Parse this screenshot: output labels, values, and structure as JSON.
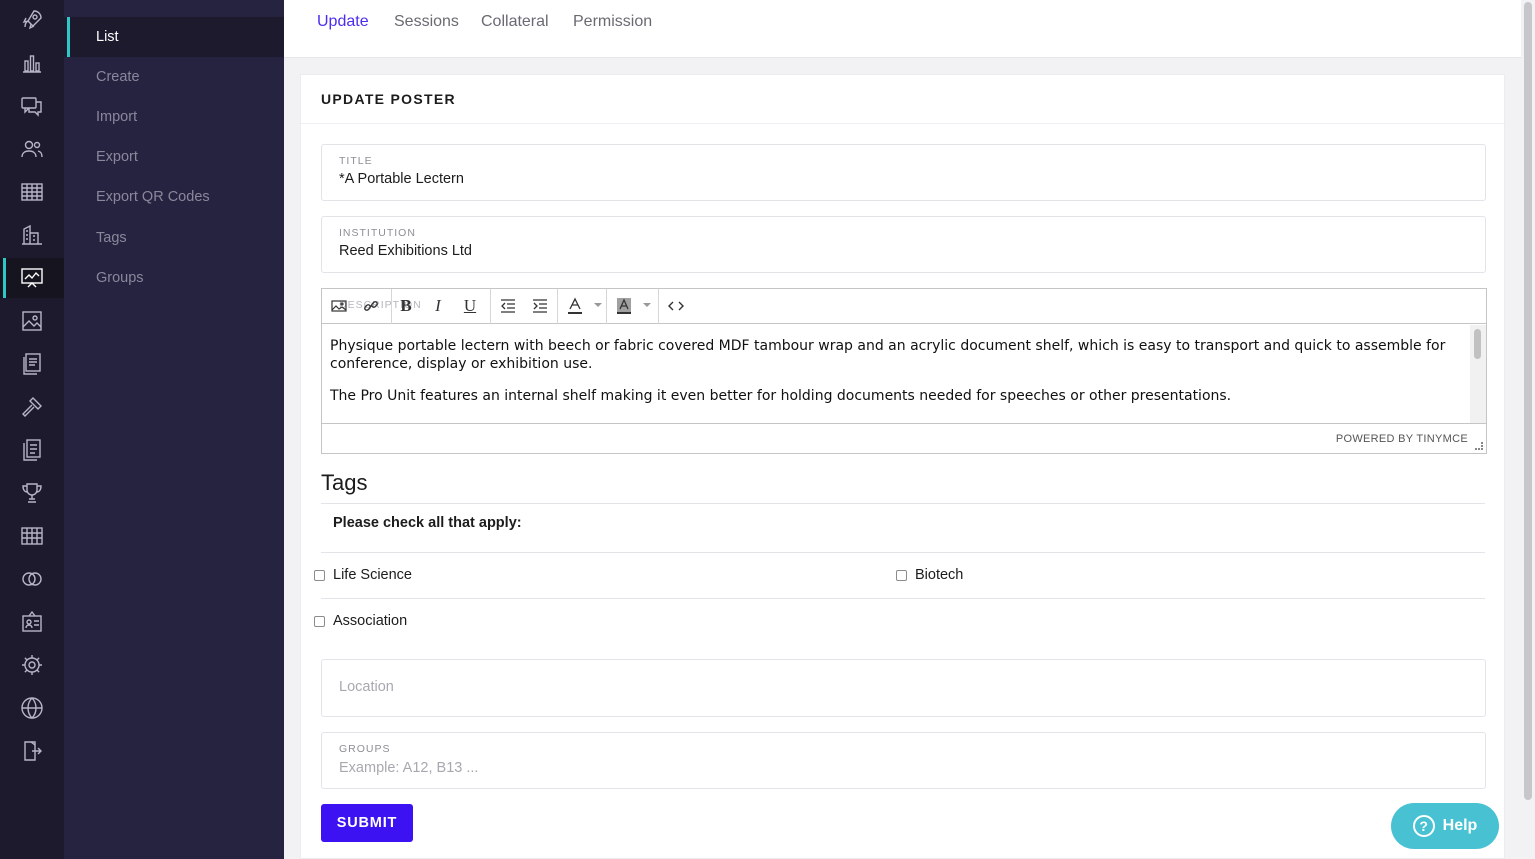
{
  "rail": {
    "icons": [
      "rocket-icon",
      "bar-chart-icon",
      "chat-icon",
      "users-icon",
      "table-icon",
      "building-icon",
      "presentation-icon",
      "gallery-icon",
      "documents-icon",
      "gavel-icon",
      "papers-icon",
      "trophy-icon",
      "grid-icon",
      "rings-icon",
      "badge-icon",
      "gear-icon",
      "globe-icon",
      "exit-icon"
    ],
    "active_index": 6,
    "accent": "#2fc6c6"
  },
  "subnav": {
    "items": [
      {
        "label": "List"
      },
      {
        "label": "Create"
      },
      {
        "label": "Import"
      },
      {
        "label": "Export"
      },
      {
        "label": "Export QR Codes"
      },
      {
        "label": "Tags"
      },
      {
        "label": "Groups"
      }
    ],
    "active_index": 0
  },
  "tabs": [
    {
      "label": "Update"
    },
    {
      "label": "Sessions"
    },
    {
      "label": "Collateral"
    },
    {
      "label": "Permission"
    }
  ],
  "card": {
    "title": "UPDATE POSTER",
    "title_field": {
      "label": "TITLE",
      "value": "*A Portable Lectern"
    },
    "institution_field": {
      "label": "INSTITUTION",
      "value": "Reed Exhibitions Ltd"
    },
    "description": {
      "label": "DESCRIPTION",
      "paragraphs": [
        "Physique portable lectern with beech or fabric covered MDF tambour wrap and an acrylic document shelf, which is easy to transport and quick to assemble for conference, display or exhibition use.",
        "The Pro Unit features an internal shelf making it even better for holding documents needed for speeches or other presentations."
      ],
      "powered_by": "POWERED BY TINYMCE",
      "toolbar": [
        "image-icon",
        "link-icon",
        "bold-icon",
        "italic-icon",
        "underline-icon",
        "outdent-icon",
        "indent-icon",
        "text-color-icon",
        "background-color-icon",
        "source-code-icon"
      ]
    },
    "tags": {
      "heading": "Tags",
      "prompt": "Please check all that apply:",
      "options": [
        {
          "label": "Life Science",
          "checked": false
        },
        {
          "label": "Biotech",
          "checked": false
        },
        {
          "label": "Association",
          "checked": false
        }
      ]
    },
    "location": {
      "placeholder": "Location"
    },
    "groups": {
      "label": "GROUPS",
      "placeholder": "Example: A12, B13 ..."
    },
    "submit_label": "SUBMIT"
  },
  "help": {
    "label": "Help"
  },
  "colors": {
    "primary": "#3d12f2",
    "active_tab": "#4b2df0",
    "help": "#48c2d3",
    "sidebar": "#262340",
    "rail": "#1d1a2e"
  }
}
